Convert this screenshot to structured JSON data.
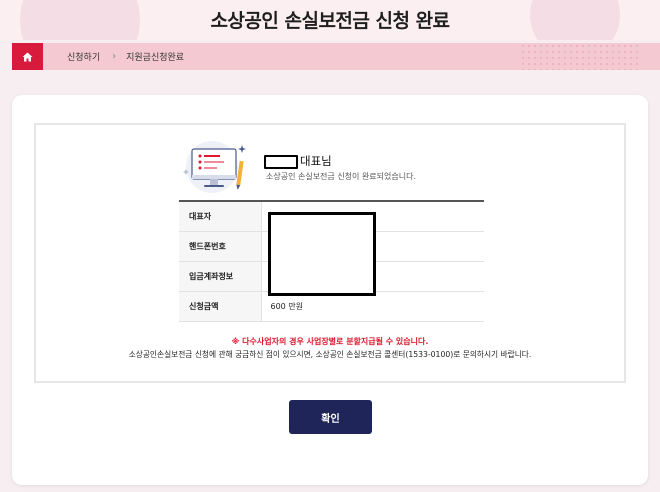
{
  "header": {
    "title": "소상공인 손실보전금 신청 완료"
  },
  "breadcrumb": {
    "home_icon": "home-icon",
    "items": [
      "신청하기",
      "지원금신청완료"
    ]
  },
  "main": {
    "greeting_suffix": "대표님",
    "greeting_sub": "소상공인 손실보전금 신청이 완료되었습니다.",
    "table": [
      {
        "label": "대표자",
        "value": ""
      },
      {
        "label": "핸드폰번호",
        "value": ""
      },
      {
        "label": "입금계좌정보",
        "value": ""
      },
      {
        "label": "신청금액",
        "value": "600 만원"
      }
    ],
    "notice": "※ 다수사업자의 경우 사업장별로 분할지급될 수 있습니다.",
    "contact": "소상공인손실보전금 신청에 관해 궁금하신 점이 있으시면, 소상공인 손실보전금 콜센터(1533-0100)로 문의하시기 바랍니다."
  },
  "confirm_label": "확인",
  "colors": {
    "accent_red": "#d81b3c",
    "button_navy": "#1f2459",
    "breadcrumb_bg": "#f4c9d1"
  }
}
